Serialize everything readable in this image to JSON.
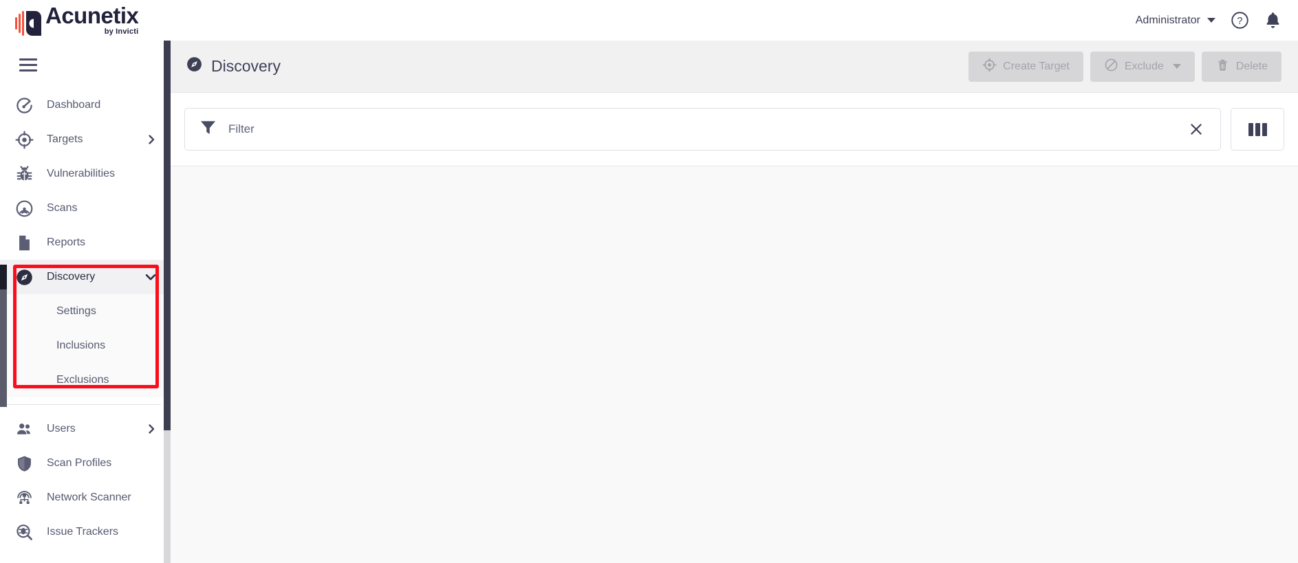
{
  "brand": {
    "name": "Acunetix",
    "tagline": "by Invicti",
    "logo_icon": "acunetix-logo-icon"
  },
  "header": {
    "user_label": "Administrator",
    "user_caret_icon": "chevron-down-icon",
    "help_icon": "help-circle-icon",
    "notifications_icon": "bell-icon",
    "menu_toggle_icon": "hamburger-menu-icon"
  },
  "sidebar": {
    "items": [
      {
        "label": "Dashboard",
        "icon": "gauge-icon",
        "active": false,
        "arrow": ""
      },
      {
        "label": "Targets",
        "icon": "crosshair-icon",
        "active": false,
        "arrow": "chevron-right-icon"
      },
      {
        "label": "Vulnerabilities",
        "icon": "bug-icon",
        "active": false,
        "arrow": ""
      },
      {
        "label": "Scans",
        "icon": "radar-icon",
        "active": false,
        "arrow": ""
      },
      {
        "label": "Reports",
        "icon": "document-icon",
        "active": false,
        "arrow": ""
      },
      {
        "label": "Discovery",
        "icon": "compass-icon",
        "active": true,
        "arrow": "chevron-down-icon"
      }
    ],
    "discovery_subitems": [
      {
        "label": "Settings"
      },
      {
        "label": "Inclusions"
      },
      {
        "label": "Exclusions"
      }
    ],
    "bottom_items": [
      {
        "label": "Users",
        "icon": "users-icon",
        "arrow": "chevron-right-icon"
      },
      {
        "label": "Scan Profiles",
        "icon": "shield-icon",
        "arrow": ""
      },
      {
        "label": "Network Scanner",
        "icon": "network-scanner-icon",
        "arrow": ""
      },
      {
        "label": "Issue Trackers",
        "icon": "issue-tracker-icon",
        "arrow": ""
      }
    ]
  },
  "page": {
    "title": "Discovery",
    "title_icon": "compass-icon"
  },
  "toolbar": {
    "buttons": [
      {
        "label": "Create Target",
        "icon": "crosshair-icon",
        "disabled": true,
        "caret": false
      },
      {
        "label": "Exclude",
        "icon": "no-entry-icon",
        "disabled": true,
        "caret": true
      },
      {
        "label": "Delete",
        "icon": "trash-icon",
        "disabled": true,
        "caret": false
      }
    ]
  },
  "filter": {
    "icon": "funnel-icon",
    "placeholder": "Filter",
    "value": "",
    "clear_icon": "close-x-icon",
    "columns_icon": "columns-icon"
  },
  "colors": {
    "brand_dark": "#22223c",
    "brand_accent": "#f4513b",
    "annotation_red": "#fc0d1c",
    "sidebar_active_bg": "#f1f1f3",
    "text_muted": "#55596e",
    "disabled_btn_bg": "#d6d6d8"
  }
}
